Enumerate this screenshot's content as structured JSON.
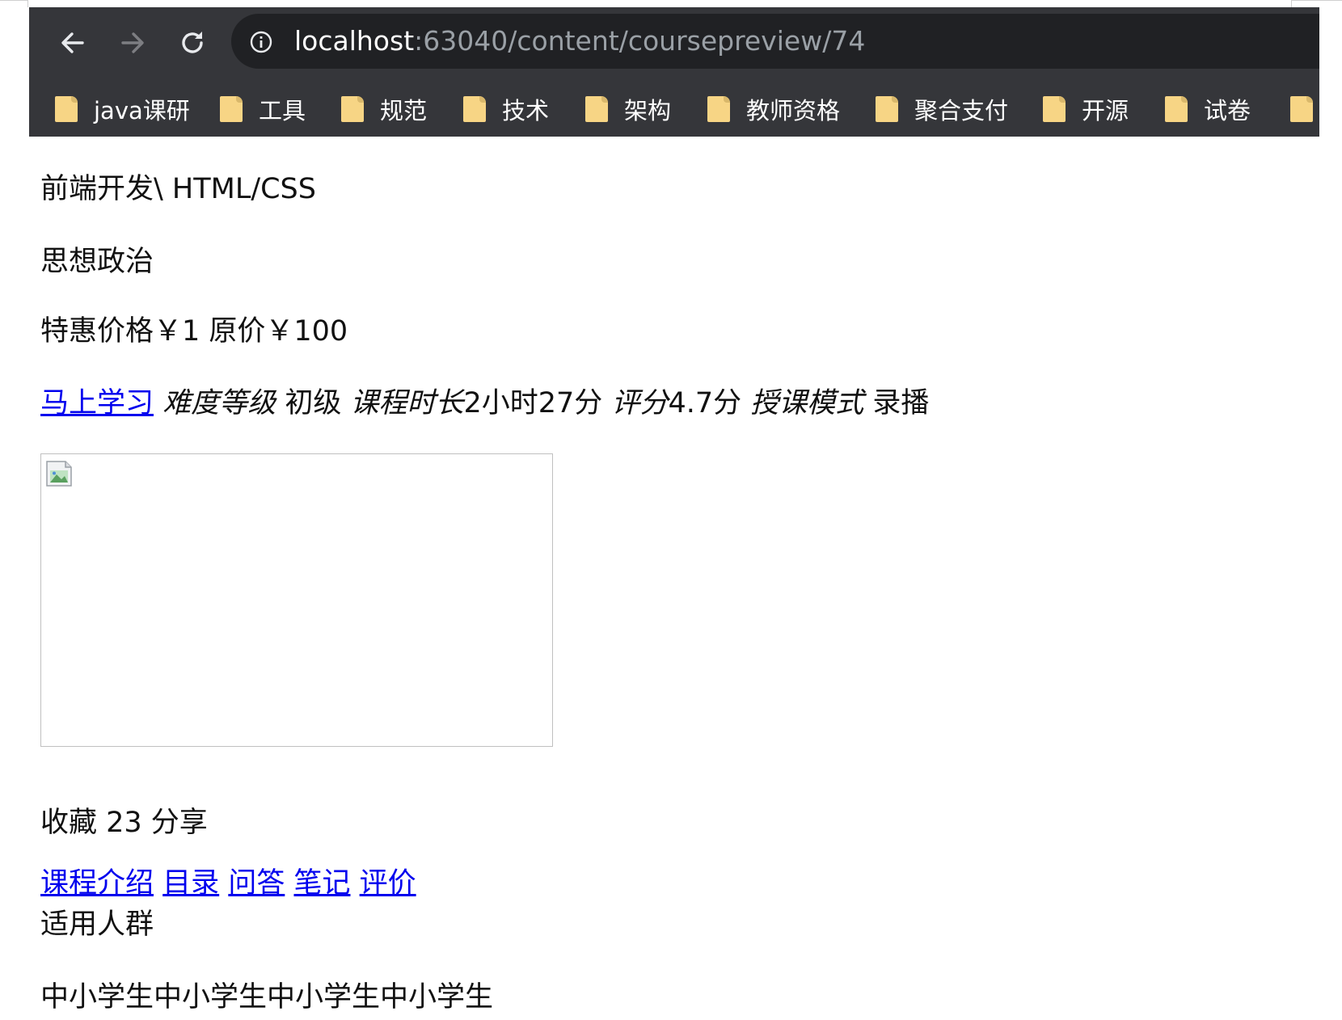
{
  "browser": {
    "url_host": "localhost",
    "url_rest": ":63040/content/coursepreview/74",
    "bookmarks": [
      "java课研",
      "工具",
      "规范",
      "技术",
      "架构",
      "教师资格",
      "聚合支付",
      "开源",
      "试卷"
    ]
  },
  "page": {
    "breadcrumb": "前端开发\\ HTML/CSS",
    "category": "思想政治",
    "price_line": "特惠价格￥1 原价￥100",
    "study_link": "马上学习",
    "difficulty_label": "难度等级",
    "difficulty_value": "初级",
    "duration_label": "课程时长",
    "duration_value": "2小时27分",
    "rating_label": "评分",
    "rating_value": "4.7分",
    "mode_label": "授课模式",
    "mode_value": "录播",
    "favorite_line": "收藏 23 分享",
    "tabs": [
      "课程介绍",
      "目录",
      "问答",
      "笔记",
      "评价"
    ],
    "audience_heading": "适用人群",
    "audience_text": "中小学生中小学生中小学生中小学生"
  }
}
